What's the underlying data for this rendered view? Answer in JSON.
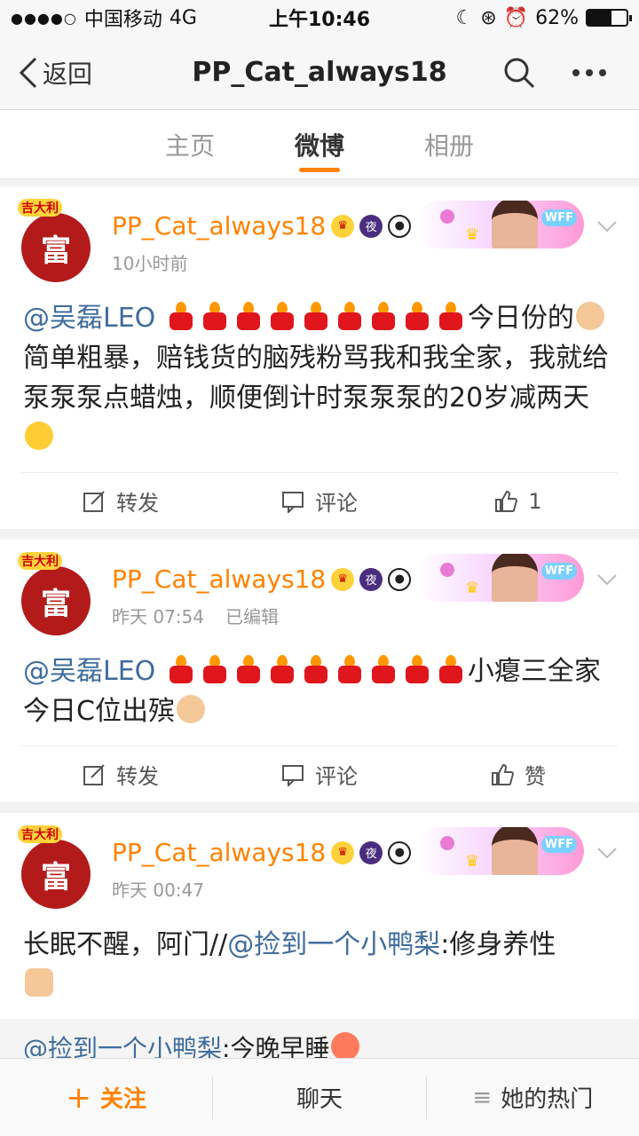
{
  "status": {
    "carrier": "中国移动",
    "network": "4G",
    "time": "上午10:46",
    "battery": "62%",
    "battery_level": 0.62
  },
  "nav": {
    "back": "返回",
    "title": "PP_Cat_always18"
  },
  "tabs": [
    {
      "label": "主页"
    },
    {
      "label": "微博"
    },
    {
      "label": "相册"
    }
  ],
  "accent": "#ff8200",
  "posts": [
    {
      "user": "PP_Cat_always18",
      "time": "10小时前",
      "edited": "",
      "mention": "@吴磊LEO",
      "text": "今日份的",
      "text2": "简单粗暴，赔钱货的脑残粉骂我和我全家，我就给泵泵泵点蜡烛，顺便倒计时泵泵泵的20岁减两天",
      "repost": "转发",
      "comment": "评论",
      "like": "1"
    },
    {
      "user": "PP_Cat_always18",
      "time": "昨天 07:54",
      "edited": "已编辑",
      "mention": "@吴磊LEO",
      "text": "小瘪三全家今日C位出殡",
      "repost": "转发",
      "comment": "评论",
      "like": "赞"
    },
    {
      "user": "PP_Cat_always18",
      "time": "昨天 00:47",
      "edited": "",
      "text_a": "长眠不醒，阿门//",
      "mention": "@捡到一个小鸭梨",
      "text_b": ":修身养性",
      "quote_mention": "@捡到一个小鸭梨",
      "quote_text": ":今晚早睡"
    }
  ],
  "avatar_text": "富",
  "avatar_badge": "吉大利",
  "bottom": {
    "follow": "关注",
    "chat": "聊天",
    "hot": "她的热门"
  }
}
